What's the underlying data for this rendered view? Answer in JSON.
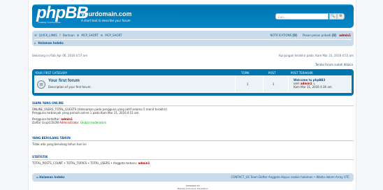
{
  "header": {
    "logo_text": "phpBB",
    "logo_tag": "creating communities",
    "site_title": "yourdomain.com",
    "site_desc": "A short text to describe your forum",
    "search_placeholder": "Cari…",
    "search_btn": "🔍",
    "adv_search_btn": "⚙"
  },
  "nav": {
    "quick_links": "QUICK_LINKS",
    "help": "Bantuan",
    "mcp_short_1": "MCP_SHORT",
    "mcp_short_2": "MCP_SHORT",
    "notifications": "NOTIFICATIONS",
    "notifications_count": "[0]",
    "pm": "Pesan-pesan pribadi",
    "pm_count": "[0]",
    "user": "admin1",
    "breadcrumb": "Halaman Indeks"
  },
  "times": {
    "now": "Sekarang ini Rab Apr 06, 2016 4:57 am",
    "last_visit": "Kunjungan terakhir pada: Kam Mar 31, 2016 4:51 am"
  },
  "mark_read": "Tandai forum sudah dibaca",
  "forum_table": {
    "headers": {
      "category": "Your first category",
      "topics": "Topik",
      "posts": "Post",
      "last_post": "Post terakhir"
    },
    "row": {
      "title": "Your first forum",
      "desc": "Description of your first forum.",
      "topics": "1",
      "posts": "1",
      "last_title": "Welcome to phpBB3",
      "last_by_prefix": "oleh",
      "last_by": "admin1",
      "last_date": "Kam Mar 31, 2016 4:36 am"
    }
  },
  "online": {
    "heading": "Siapa yang online",
    "line1": "ONLINE_USERS_TOTAL_GUESTS (didasarkan pada pengguna yang aktif selama 5 menit terakhir)",
    "line2": "Pengguna terbanyak yang pernah online 1 pada Kam Mar 31, 2016 4:51 am",
    "registered_label": "Pengguna terdaftar:",
    "registered_user": "admin1",
    "legend_label": "Daftar GrupCOLON",
    "legend_admin": "Administrator,",
    "legend_mod": "Global moderators"
  },
  "birthdays": {
    "heading": "Yang berulang tahun",
    "text": "Tidak ada yang berulang tahun hari ini"
  },
  "stats": {
    "heading": "Statistik",
    "text": "TOTAL_POSTS_COUNT • TOTAL_TOPICS • TOTAL_USERS • Anggota terbaru:",
    "newest": "admin1"
  },
  "footer": {
    "crumb": "Halaman Indeks",
    "links": "CONTACT_US  Team  Daftar Anggota  Hapus cookie halaman  • Waktu dalam Array UTC",
    "powered_by": "POWERED BY",
    "powered_line2": "Bahasa Indonesia Translation"
  }
}
